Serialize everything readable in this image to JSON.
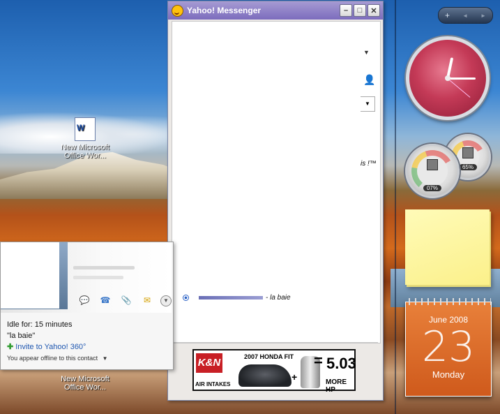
{
  "window": {
    "title": "Yahoo! Messenger",
    "minimize_label": "–",
    "maximize_label": "□",
    "close_label": "✕"
  },
  "chat": {
    "status_fragment": "is !™",
    "contact_status": "- la baie"
  },
  "ad": {
    "brand": "K&N",
    "brand_sub": "AIR INTAKES",
    "title": "2007 HONDA FIT",
    "equals": "=",
    "value": "5.03",
    "unit": "MORE HP",
    "plus": "+"
  },
  "popup": {
    "idle": "Idle for: 15 minutes",
    "status_message": "\"la baie\"",
    "invite_link": "Invite to Yahoo! 360°",
    "offline_text": "You appear offline to this contact",
    "offline_arrow": "▼"
  },
  "desktop_icons": [
    {
      "label_line1": "New Microsoft",
      "label_line2": "Office Wor..."
    },
    {
      "label_line1": "New Microsoft",
      "label_line2": "Office Wor..."
    }
  ],
  "sidebar": {
    "add_label": "+",
    "prev_label": "◄",
    "next_label": "►",
    "meter1_pct": "07%",
    "meter2_pct": "65%",
    "calendar_month": "June 2008",
    "calendar_day": "23",
    "calendar_weekday": "Monday"
  },
  "icons": [
    "smiley-icon",
    "minimize-icon",
    "maximize-icon",
    "close-icon",
    "person-icon",
    "chevron-down-icon",
    "radio-icon",
    "chat-icon",
    "phone-icon",
    "file-icon",
    "mail-icon",
    "plus-icon"
  ]
}
